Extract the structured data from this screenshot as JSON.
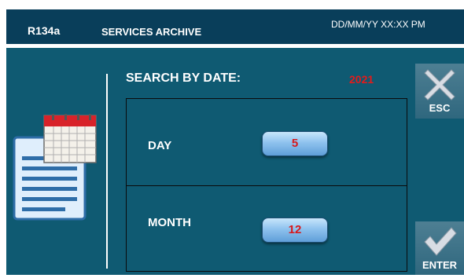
{
  "header": {
    "model": "R134a",
    "title": "SERVICES ARCHIVE",
    "datetime": "DD/MM/YY XX:XX PM"
  },
  "search": {
    "label": "SEARCH BY DATE:",
    "year": "2021"
  },
  "fields": {
    "day": {
      "label": "DAY",
      "value": "5"
    },
    "month": {
      "label": "MONTH",
      "value": "12"
    }
  },
  "buttons": {
    "esc": "ESC",
    "enter": "ENTER"
  },
  "icons": {
    "archive": "calendar-document-icon",
    "esc": "x-icon",
    "enter": "checkmark-icon"
  },
  "colors": {
    "header_bg": "#093e5a",
    "content_bg": "#0f5a72",
    "accent_red": "#e21b1b",
    "value_button": "#8fc2ee"
  }
}
